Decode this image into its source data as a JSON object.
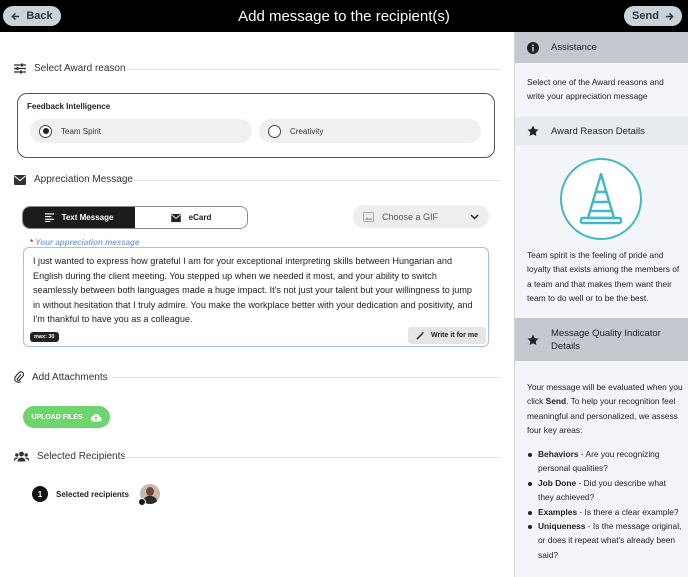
{
  "header": {
    "title": "Add message to the recipient(s)",
    "back_label": "Back",
    "send_label": "Send"
  },
  "award_reason": {
    "section_title": "Select Award reason",
    "group_label": "Feedback Intelligence",
    "options": [
      {
        "label": "Team Spirit",
        "selected": true
      },
      {
        "label": "Creativity",
        "selected": false
      }
    ]
  },
  "appreciation": {
    "section_title": "Appreciation Message",
    "tabs": [
      {
        "label": "Text Message",
        "active": true
      },
      {
        "label": "eCard",
        "active": false
      }
    ],
    "gif_select": "Choose a GIF",
    "message_label": "Your appreciation message",
    "message_required_mark": "*",
    "message_text": "I just wanted to express how grateful I am for your exceptional interpreting skills between Hungarian and English during the client meeting. You stepped up when we needed it most, and your ability to switch seamlessly between both languages made a huge impact. It's not just your talent but your willingness to jump in without hesitation that I truly admire. You make the workplace better with your dedication and positivity, and I'm thankful to have you as a colleague.",
    "max_badge": "max: 30",
    "write_button": "Write it for me"
  },
  "attachments": {
    "section_title": "Add Attachments",
    "upload_button": "UPLOAD FILES"
  },
  "recipients": {
    "section_title": "Selected Recipients",
    "count": "1",
    "label": "Selected recipients"
  },
  "sidebar": {
    "assistance_title": "Assistance",
    "assistance_text": "Select one of the Award reasons and write your appreciation message",
    "award_details_title": "Award Reason Details",
    "award_details_text": "Team spirit is the feeling of pride and loyalty that exists among the members of a team and that makes them want their team to do well or to be the best.",
    "quality_title": "Message Quality Indicator Details",
    "quality_intro_a": "Your message will be evaluated when you click ",
    "quality_intro_bold": "Send",
    "quality_intro_b": ". To help your recognition feel meaningful and personalized, we assess four key areas:",
    "criteria": [
      {
        "name": "Behaviors",
        "desc": " - Are you recognizing personal qualities?"
      },
      {
        "name": "Job Done",
        "desc": " - Did you describe what they achieved?"
      },
      {
        "name": "Examples",
        "desc": " - Is there a clear example?"
      },
      {
        "name": "Uniqueness",
        "desc": " - Is the message original, or does it repeat what's already been said?"
      }
    ]
  },
  "colors": {
    "accent_teal": "#43b8c2",
    "upload_green": "#6ed56e",
    "header_bg": "#000000"
  }
}
